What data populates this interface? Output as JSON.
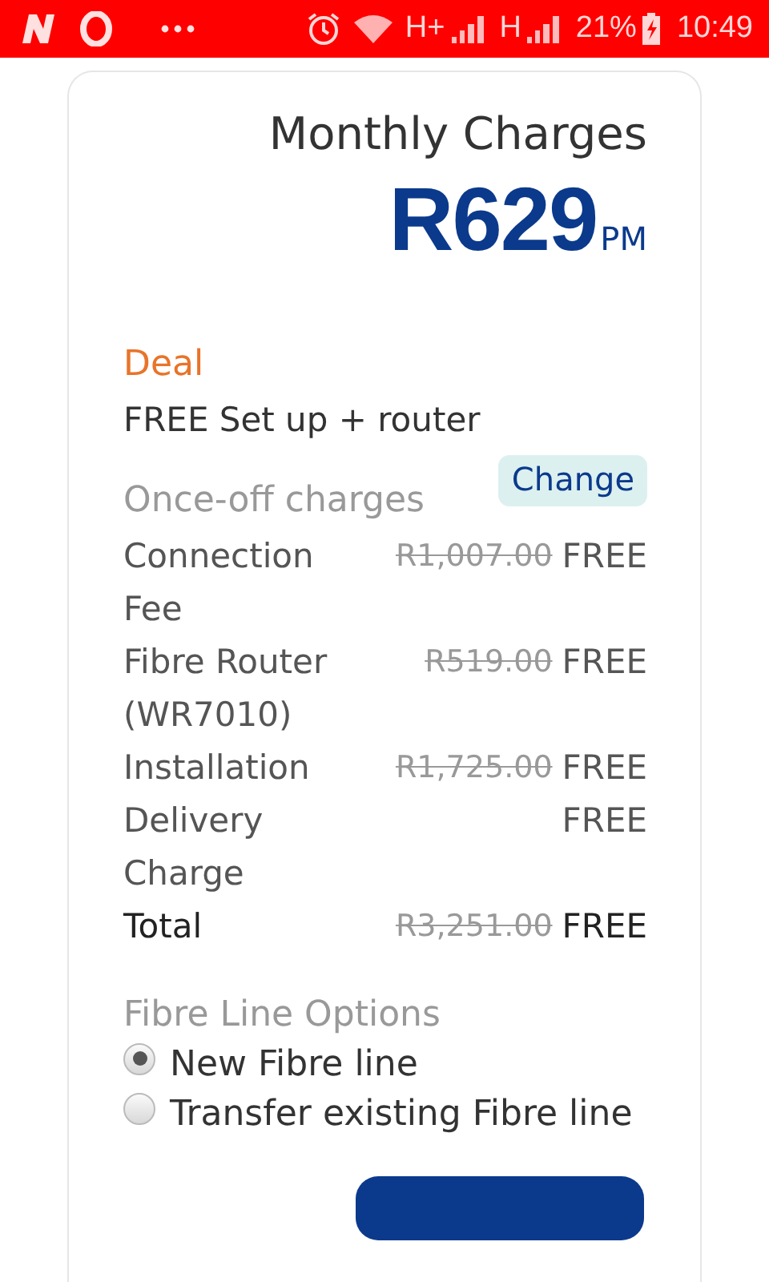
{
  "status_bar": {
    "network_1": "H+",
    "network_2": "H",
    "battery": "21%",
    "time": "10:49"
  },
  "monthly": {
    "title": "Monthly Charges",
    "amount": "R629",
    "period": "PM"
  },
  "deal": {
    "label": "Deal",
    "description": "FREE Set up + router",
    "change_button": "Change"
  },
  "once_off": {
    "title": "Once-off charges",
    "rows": [
      {
        "kind": "item",
        "label": "Connection Fee",
        "was": "R1,007.00",
        "now": "FREE"
      },
      {
        "kind": "item",
        "label": "Fibre Router (WR7010)",
        "was": "R519.00",
        "now": "FREE"
      },
      {
        "kind": "item",
        "label": "Installation",
        "was": "R1,725.00",
        "now": "FREE"
      },
      {
        "kind": "item",
        "label": "Delivery Charge",
        "now": "FREE"
      },
      {
        "kind": "total",
        "label": "Total",
        "was": "R3,251.00",
        "now": "FREE"
      }
    ]
  },
  "fibre_options": {
    "title": "Fibre Line Options",
    "options": [
      {
        "label": "New Fibre line",
        "selected": true
      },
      {
        "label": "Transfer existing Fibre line",
        "selected": false
      }
    ]
  }
}
